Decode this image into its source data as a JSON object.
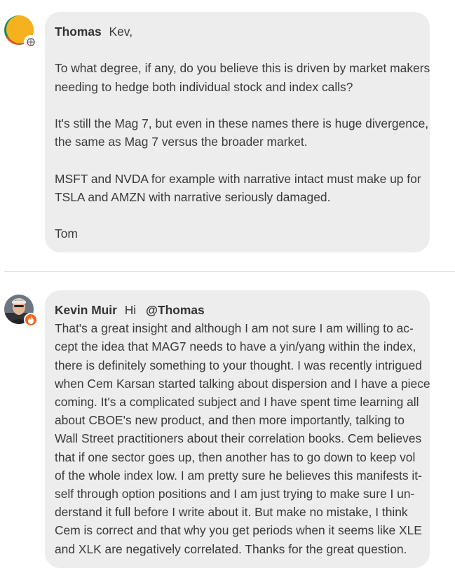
{
  "colors": {
    "bubble_bg": "#ededed",
    "avatar1_primary": "#f5b21e",
    "avatar1_accent": "#1d8a5a",
    "badge2": "#f26522"
  },
  "comments": [
    {
      "author": "Thomas",
      "badge_icon": "globe-icon",
      "first_line": "Kev,",
      "paragraphs": [
        [
          "To what degree, if any, do you believe this is driven by market makers",
          "needing to hedge both individual stock and index calls?"
        ],
        [
          "It's still the Mag 7, but even in these names there is huge divergence,",
          "the same as Mag 7 versus the broader market."
        ],
        [
          "MSFT and NVDA for example with narrative intact must make up for",
          "TSLA and AMZN with narrative seriously damaged."
        ],
        [
          "Tom"
        ]
      ]
    },
    {
      "author": "Kevin Muir",
      "badge_icon": "flame-icon",
      "greeting": "Hi",
      "mention": "@Thomas",
      "lines": [
        "That's a great insight and although I am not sure I am willing to ac-",
        "cept the idea that MAG7 needs to have a yin/yang within the index,",
        "there is definitely something to your thought. I was recently intrigued",
        "when Cem Karsan started talking about dispersion and I have a piece",
        "coming. It's a complicated subject and I have spent time learning all",
        "about CBOE's new product, and then more importantly, talking to",
        "Wall Street practitioners about their correlation books. Cem believes",
        "that if one sector goes up, then another has to go down to keep vol",
        "of the whole index low. I am pretty sure he believes this manifests it-",
        "self through option positions and I am just trying to make sure I un-",
        "derstand it full before I write about it. But make no mistake, I think",
        "Cem is correct and that why you get periods when it seems like XLE",
        "and XLK are negatively correlated. Thanks for the great question."
      ]
    }
  ]
}
